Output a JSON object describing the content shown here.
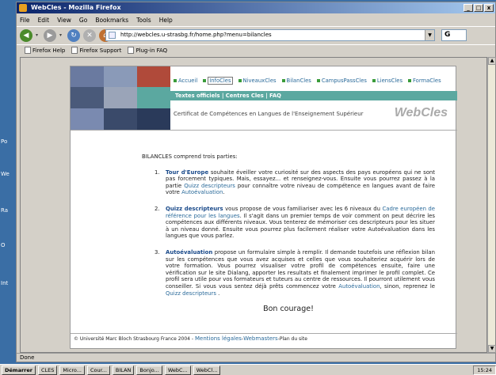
{
  "desktop": {
    "labels": [
      "Po",
      "We",
      "Ra",
      "O",
      "Int"
    ]
  },
  "window": {
    "title": "WebCles - Mozilla Firefox",
    "buttons": {
      "minimize": "_",
      "maximize": "□",
      "close": "x"
    }
  },
  "menu": {
    "items": [
      "File",
      "Edit",
      "View",
      "Go",
      "Bookmarks",
      "Tools",
      "Help"
    ]
  },
  "toolbar": {
    "url": "http://webcles.u-strasbg.fr/home.php?menu=bilancles",
    "go_label": "G"
  },
  "bookmarks": {
    "items": [
      "Firefox Help",
      "Firefox Support",
      "Plug-in FAQ"
    ]
  },
  "site": {
    "topnav": [
      "Accueil",
      "InfoCles",
      "NiveauxCles",
      "BilanCles",
      "CampusPassCles",
      "LiensCles",
      "FormaCles"
    ],
    "active_nav": "InfoCles",
    "tealbar": "Textes officiels | Centres Cles | FAQ",
    "subtitle": "Certificat de Compétences en Langues de l'Enseignement Supérieur",
    "brand": "WebCles"
  },
  "content": {
    "intro": "BILANCLES comprend trois parties:",
    "items": [
      {
        "num": "1.",
        "strong": "Tour d'Europe",
        "text1": " souhaite éveiller votre curiosité sur des aspects des pays européens qui ne sont pas forcement typiques. Mais, essayez... et renseignez-vous. Ensuite vous pourrez passez à la partie ",
        "link1": "Quizz descripteurs",
        "text2": " pour connaître votre niveau de compétence en langues avant de faire votre ",
        "link2": "Autoévaluation",
        "text3": "."
      },
      {
        "num": "2.",
        "strong": "Quizz descripteurs",
        "text1": " vous propose de vous familiariser avec les 6 niveaux du ",
        "link1": "Cadre européen de référence pour les langues",
        "text2": ". Il s'agit dans un premier temps de voir comment on peut décrire les compétences aux différents niveaux. Vous tenterez de mémoriser ces descripteurs pour les situer à un niveau donné. Ensuite vous pourrez plus facilement réaliser votre Autoévaluation dans les langues que vous parlez."
      },
      {
        "num": "3.",
        "strong": "Autoévaluation",
        "text1": " propose un formulaire simple à remplir. Il demande toutefois une réflexion bilan sur les compétences que vous avez acquises et celles que vous souhaiteriez acquérir lors de votre formation. Vous pourrez visualiser votre profil de compétences ensuite, faire une vérification sur le site Dialang, apporter les resultats et finalement imprimer le profil complet. Ce profil sera utile pour vos formateurs et tuteurs au centre de ressources. Il pourront utilement vous conseiller. Si vous vous sentez déjà prêts commencez votre ",
        "link1": "Autoévaluation",
        "text2": ", sinon, reprenez le ",
        "link2": "Quizz descripteurs",
        "text3": " ."
      }
    ],
    "closing": "Bon courage!"
  },
  "footer": {
    "copyright": "© Université Marc Bloch Strasbourg France 2004 - ",
    "link1": "Mentions légales",
    "sep": "-",
    "link2": "Webmasters",
    "suffix": "-Plan du site"
  },
  "status": {
    "text": "Done"
  },
  "taskbar": {
    "start": "Démarrer",
    "tasks": [
      "CLES",
      "Micro...",
      "Cour...",
      "BILAN",
      "Bonjo...",
      "WebC...",
      "WebCl..."
    ],
    "time": "15:24"
  },
  "colors": {
    "teal": "#5ba8a0",
    "link": "#2a6a9a",
    "nav_bullet": "#3a9b3a"
  }
}
